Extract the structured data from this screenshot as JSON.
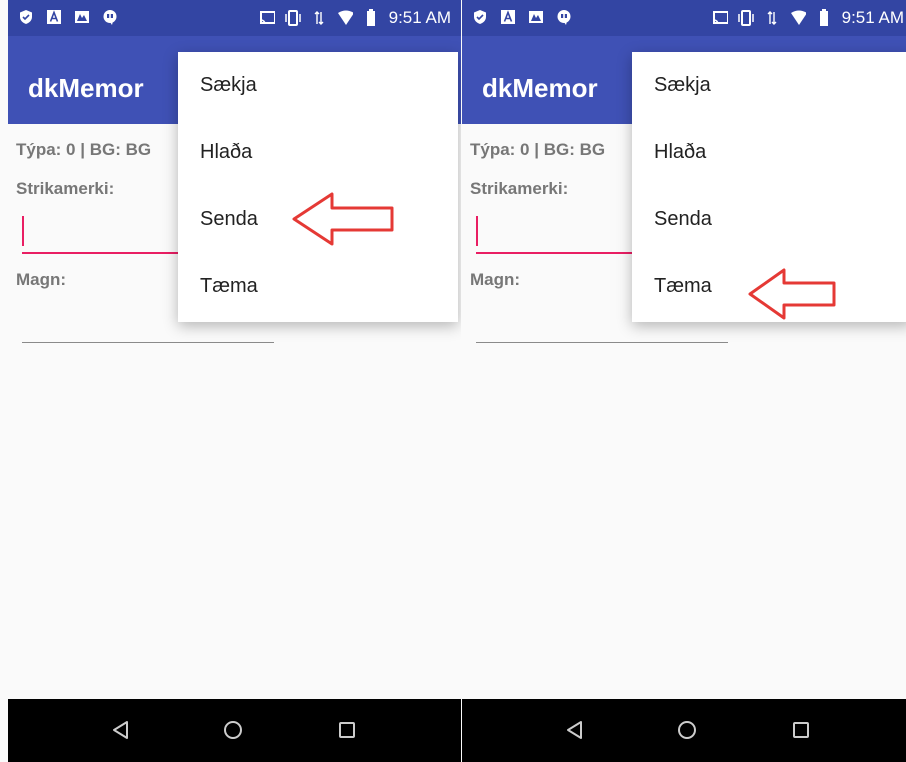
{
  "panels": [
    {
      "status": {
        "time": "9:51 AM"
      },
      "app_title": "dkMemor",
      "labels": {
        "type_bg": "Týpa: 0 | BG: BG",
        "barcode": "Strikamerki:",
        "quantity": "Magn:"
      },
      "menu": {
        "items": [
          "Sækja",
          "Hlaða",
          "Senda",
          "Tæma"
        ]
      },
      "highlighted_item": "Senda"
    },
    {
      "status": {
        "time": "9:51 AM"
      },
      "app_title": "dkMemor",
      "labels": {
        "type_bg": "Týpa: 0 | BG: BG",
        "barcode": "Strikamerki:",
        "quantity": "Magn:"
      },
      "menu": {
        "items": [
          "Sækja",
          "Hlaða",
          "Senda",
          "Tæma"
        ]
      },
      "highlighted_item": "Tæma"
    }
  ],
  "icons": [
    "shield-icon",
    "a-icon",
    "gallery-icon",
    "chat-icon",
    "cast-icon",
    "vibrate-icon",
    "data-icon",
    "wifi-icon",
    "battery-icon",
    "back-icon",
    "home-icon",
    "recents-icon",
    "arrow-left-icon"
  ],
  "colors": {
    "statusbar": "#3345a3",
    "appbar": "#3f51b5",
    "accent": "#e91e63",
    "annotation": "#e53935"
  }
}
